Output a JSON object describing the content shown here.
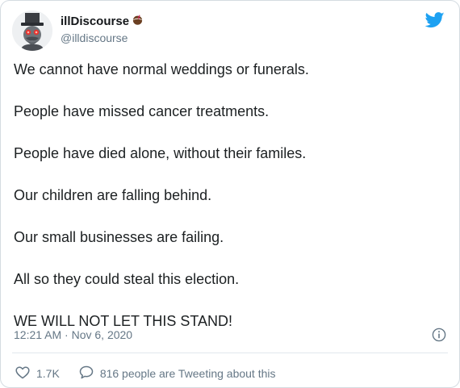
{
  "author": {
    "display_name": "illDiscourse",
    "handle": "@illdiscourse"
  },
  "tweet": {
    "lines": [
      "We cannot have normal weddings or funerals.",
      "People have missed cancer treatments.",
      "People have died alone, without their familes.",
      "Our children are falling behind.",
      "Our small businesses are failing.",
      "All so they could steal this election.",
      "WE WILL NOT LET THIS STAND!"
    ],
    "timestamp": "12:21 AM · Nov 6, 2020"
  },
  "actions": {
    "likes": "1.7K",
    "conversation": "816 people are Tweeting about this"
  },
  "colors": {
    "twitter_blue": "#1da1f2",
    "like_red": "#e0245e",
    "secondary_text": "#657786"
  },
  "icons": {
    "brand": "twitter-bird-icon",
    "emoji": "coconut-emoji-icon",
    "info": "info-icon",
    "like": "heart-icon",
    "reply": "speech-bubble-icon"
  }
}
